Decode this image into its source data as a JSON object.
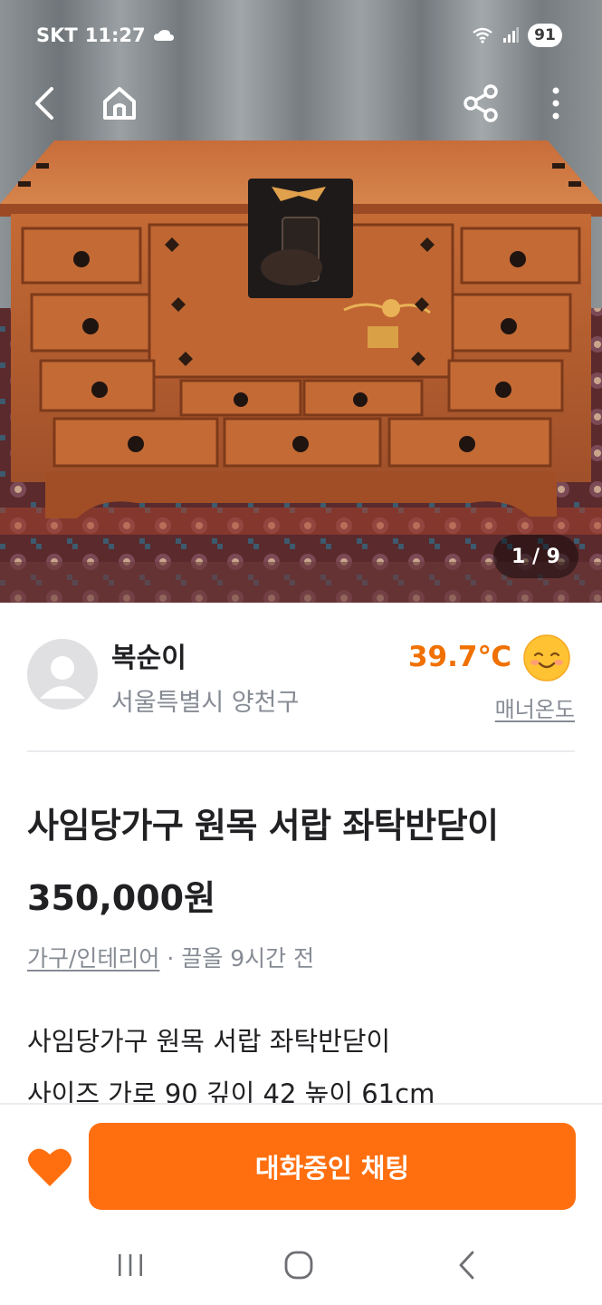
{
  "status_bar": {
    "carrier": "SKT",
    "time": "11:27",
    "battery": "91"
  },
  "image_counter": "1 / 9",
  "seller": {
    "name": "복순이",
    "location": "서울특별시 양천구",
    "manner_temperature": "39.7℃",
    "manner_label": "매너온도"
  },
  "product": {
    "title": "사임당가구 원목 서랍 좌탁반닫이",
    "price": "350,000원",
    "category": "가구/인테리어",
    "time_info": " · 끌올 9시간 전",
    "description_lines": [
      "사임당가구 원목 서랍 좌탁반닫이",
      "사이즈 가로 90 깊이 42 높이 61cm"
    ]
  },
  "bottom_bar": {
    "chat_button_label": "대화중인 채팅"
  },
  "colors": {
    "accent": "#ff6f0f",
    "temperature": "#f07000",
    "muted_text": "#868b94"
  },
  "icons": [
    "cloud-icon",
    "wifi-icon",
    "signal-icon",
    "back-arrow-icon",
    "home-icon",
    "share-icon",
    "more-vertical-icon",
    "smile-face-icon",
    "heart-icon",
    "recents-icon",
    "circle-home-icon",
    "chevron-left-icon"
  ]
}
